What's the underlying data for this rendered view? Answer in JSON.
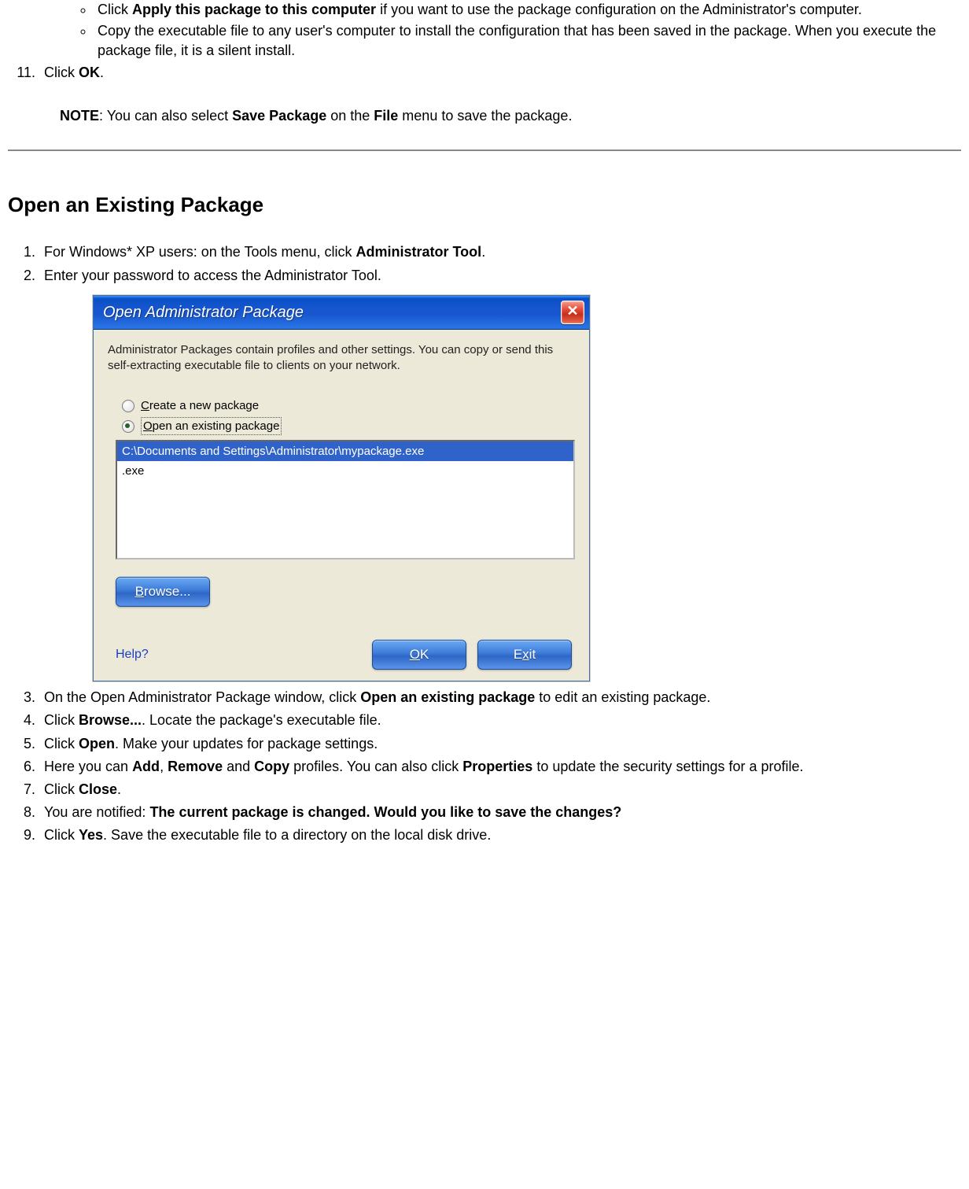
{
  "top_sublist": [
    {
      "pre": "Click ",
      "bold": "Apply this package to this computer",
      "post": " if you want to use the package configuration on the Administrator's computer."
    },
    {
      "pre": "",
      "bold": "",
      "post": "Copy the executable file to any user's computer to install the configuration that has been saved in the package. When you execute the package file, it is a silent install."
    }
  ],
  "step11": {
    "pre": "Click ",
    "bold": "OK",
    "post": "."
  },
  "note": {
    "label": "NOTE",
    "text_pre": ": You can also select ",
    "bold1": "Save Package",
    "mid": " on the ",
    "bold2": "File",
    "post": " menu to save the package."
  },
  "section_title": "Open an Existing Package",
  "steps": {
    "s1": {
      "pre": "For Windows* XP users: on the Tools menu, click ",
      "bold": "Administrator Tool",
      "post": "."
    },
    "s2": "Enter your password to access the Administrator Tool.",
    "s3": {
      "pre": "On the Open Administrator Package window, click ",
      "bold": "Open an existing package",
      "post": " to edit an existing package."
    },
    "s4": {
      "pre": "Click ",
      "bold": "Browse...",
      "post": ". Locate the package's executable file."
    },
    "s5": {
      "pre": "Click ",
      "bold": "Open",
      "post": ". Make your updates for package settings."
    },
    "s6": {
      "pre": "Here you can ",
      "b1": "Add",
      "t1": ", ",
      "b2": "Remove",
      "t2": " and ",
      "b3": "Copy",
      "t3": " profiles. You can also click ",
      "b4": "Properties",
      "t4": " to update the security settings for a profile."
    },
    "s7": {
      "pre": "Click ",
      "bold": "Close",
      "post": "."
    },
    "s8": {
      "pre": "You are notified: ",
      "bold": "The current package is changed. Would you like to save the changes?",
      "post": ""
    },
    "s9": {
      "pre": "Click ",
      "bold": "Yes",
      "post": ". Save the executable file to a directory on the local disk drive."
    }
  },
  "dialog": {
    "title": "Open Administrator Package",
    "close_glyph": "✕",
    "description": "Administrator Packages contain profiles and other settings. You can copy or send this self-extracting executable file to clients on your network.",
    "radio_create": "Create a new package",
    "radio_open": "Open an existing package",
    "list_selected": "C:\\Documents and Settings\\Administrator\\mypackage.exe",
    "list_row2": ".exe",
    "browse": "Browse...",
    "help": "Help?",
    "ok": "OK",
    "exit": "Exit"
  }
}
